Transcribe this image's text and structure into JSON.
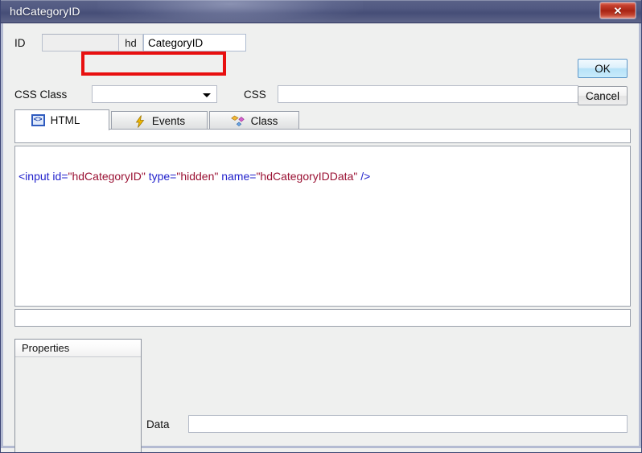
{
  "window": {
    "title": "hdCategoryID",
    "close_label": "✕"
  },
  "form": {
    "id_label": "ID",
    "id_readonly_value": "",
    "id_prefix": "hd",
    "id_value": "CategoryID",
    "css_class_label": "CSS Class",
    "css_class_value": "",
    "css_class_placeholder": "",
    "css_label": "CSS",
    "css_value": "",
    "css_placeholder": ""
  },
  "buttons": {
    "ok": "OK",
    "cancel": "Cancel"
  },
  "tabs": [
    {
      "label": "HTML",
      "icon": "code-brackets-icon",
      "glyph": "<>",
      "active": true
    },
    {
      "label": "Events",
      "icon": "lightning-bolt-icon",
      "active": false
    },
    {
      "label": "Class",
      "icon": "diamonds-icon",
      "active": false
    }
  ],
  "editor": {
    "tokens": [
      {
        "text": "<input id=",
        "type": "tag"
      },
      {
        "text": "\"hdCategoryID\"",
        "type": "val"
      },
      {
        "text": " type=",
        "type": "tag"
      },
      {
        "text": "\"hidden\"",
        "type": "val"
      },
      {
        "text": " name=",
        "type": "tag"
      },
      {
        "text": "\"hdCategoryIDData\"",
        "type": "val"
      },
      {
        "text": " />",
        "type": "tag"
      }
    ],
    "plain_text": "<input id=\"hdCategoryID\" type=\"hidden\" name=\"hdCategoryIDData\" />"
  },
  "properties": {
    "header": "Properties",
    "items": []
  },
  "data_field": {
    "label": "Data",
    "value": "",
    "placeholder": ""
  },
  "colors": {
    "titlebar": "#4d5580",
    "highlight_red": "#e81010",
    "tag_blue": "#2222cc",
    "value_maroon": "#9a1133",
    "close_red": "#a82414",
    "ok_blue": "#b6e2f8"
  }
}
